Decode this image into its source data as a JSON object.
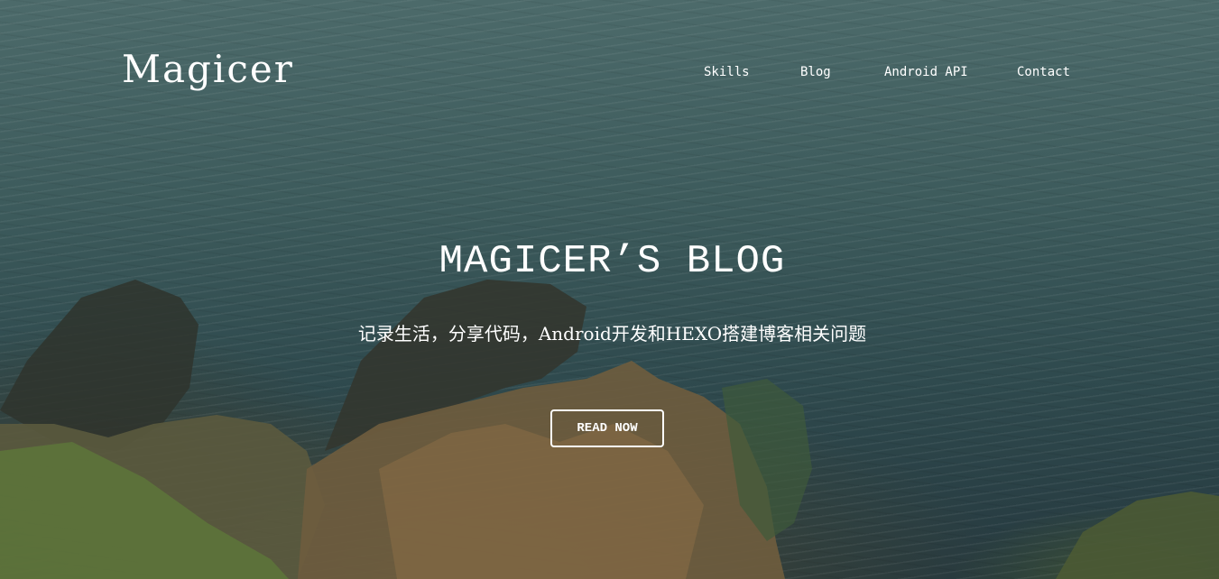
{
  "site": {
    "brand": "Magicer"
  },
  "nav": {
    "items": [
      {
        "label": "Skills"
      },
      {
        "label": "Blog"
      },
      {
        "label": "Android API"
      },
      {
        "label": "Contact"
      }
    ]
  },
  "hero": {
    "title": "MAGICER’S BLOG",
    "subtitle": "记录生活，分享代码，Android开发和HEXO搭建博客相关问题",
    "button_label": "READ NOW",
    "background": "ocean-coastline-rocks"
  },
  "colors": {
    "text": "#ffffff",
    "water": "#3d5b5c",
    "rock": "#7a6a4a"
  }
}
